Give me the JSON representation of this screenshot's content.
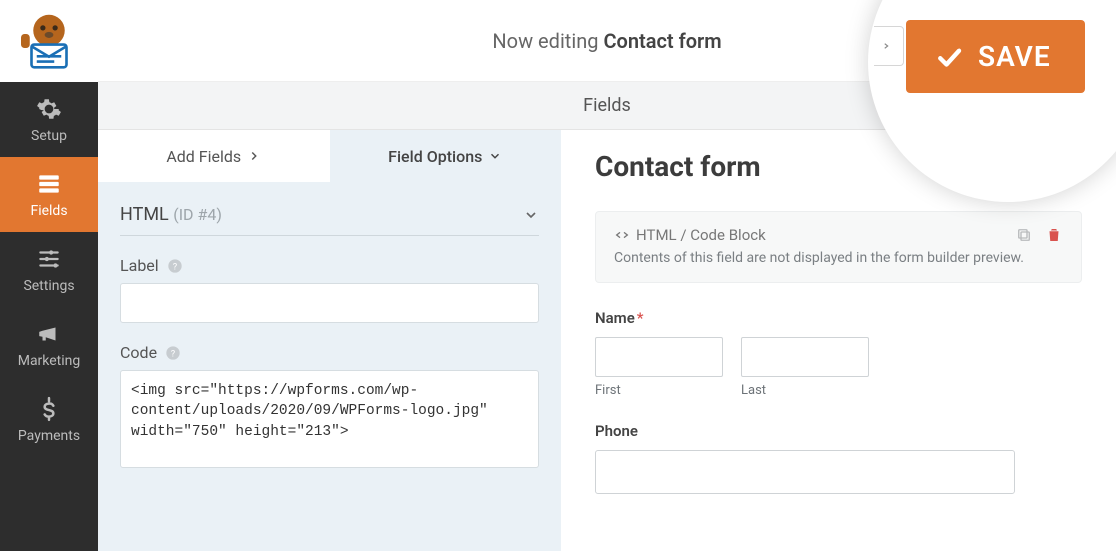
{
  "sidebar": {
    "items": [
      {
        "label": "Setup"
      },
      {
        "label": "Fields"
      },
      {
        "label": "Settings"
      },
      {
        "label": "Marketing"
      },
      {
        "label": "Payments"
      }
    ]
  },
  "topbar": {
    "editing_prefix": "Now editing ",
    "form_name": "Contact form",
    "save_label": "SAVE"
  },
  "fields_header": "Fields",
  "tabs": {
    "add": "Add Fields",
    "options": "Field Options"
  },
  "panel": {
    "section_type": "HTML",
    "section_id": "(ID #4)",
    "label_label": "Label",
    "label_value": "",
    "code_label": "Code",
    "code_value": "<img src=\"https://wpforms.com/wp-content/uploads/2020/09/WPForms-logo.jpg\" width=\"750\" height=\"213\">"
  },
  "preview": {
    "title": "Contact form",
    "html_block_title": "HTML / Code Block",
    "html_block_desc": "Contents of this field are not displayed in the form builder preview.",
    "name_label": "Name",
    "first_sub": "First",
    "last_sub": "Last",
    "phone_label": "Phone"
  }
}
